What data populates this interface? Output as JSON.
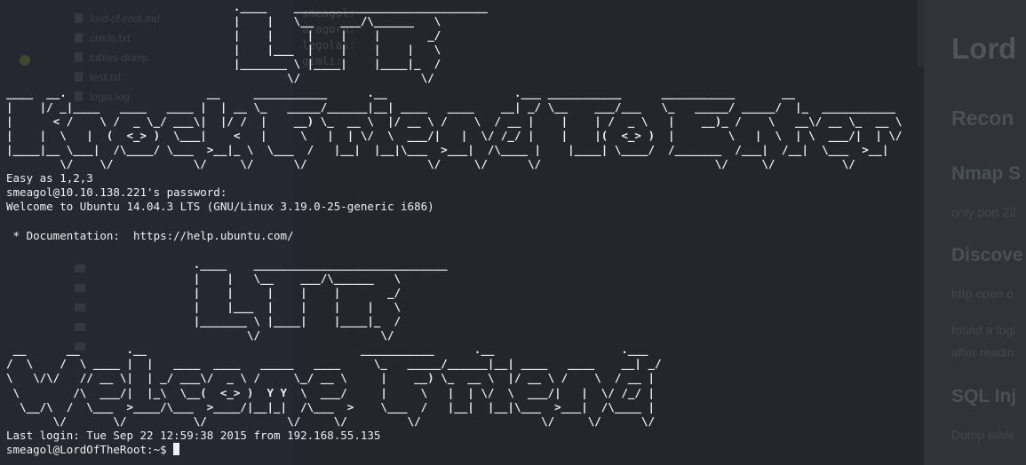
{
  "editor": {
    "files": [
      {
        "kind": "file",
        "name": "lord-of-root.md"
      },
      {
        "kind": "file",
        "name": "creds.txt"
      },
      {
        "kind": "file",
        "name": "tables-dump"
      },
      {
        "kind": "file",
        "name": "test.txt"
      },
      {
        "kind": "file",
        "name": "login.log"
      },
      {
        "kind": "folder",
        "name": ""
      },
      {
        "kind": "folder",
        "name": ""
      },
      {
        "kind": "folder",
        "name": ""
      },
      {
        "kind": "folder",
        "name": ""
      },
      {
        "kind": "folder",
        "name": ""
      }
    ],
    "creds_preview": "smeagol:\naragorn:\nlegolas:\ngimli:"
  },
  "preview": {
    "title": "Lord",
    "recon": "Recon",
    "nmap": "Nmap S",
    "nmap_text": "only port 22",
    "discover": "Discove",
    "discover_text_1": "http open o",
    "discover_text_2": "found a logi",
    "discover_text_3": "after readin",
    "sqli": "SQL Inj",
    "sqli_text": "Dump table"
  },
  "terminal": {
    "banner_ltr_top": "                                  .____    _____________________________\n                                  |    |   \\__    ___/\\______   \\\n                                  |    |     |    |    |       _/\n                                  |    |___  |    |    |    |   \\\n                                  |_______ \\ |____|    |____|_  /\n                                          \\/                  \\/",
    "banner_knock": "____  __.                     __     ___________      .__                   .___ ___________      ___________       __\n|    |/ _|____   ____   ____ |  | __ \\_   _____/______|__| ____   ____    __| _/ \\__    ___/___   \\_   _____/ _____/  |_  ___________\n|      < /    \\ /  _ \\_/ ___\\|  |/ /  |    __) \\_  __ \\  |/ __ \\ /    \\  / __ |    |    | /  _ \\   |    __)_ /    \\   __\\/ __ \\_  __ \\\n|    |  \\   |  (  <_> )  \\___|    <   |     \\   |  | \\/  \\  ___/|   |  \\/ /_/ |    |    |(  <_> )  |        \\   |  \\  | \\  ___/|  | \\/\n|____|__ \\___|  /\\____/ \\___  >__|_ \\  \\___  /   |__|  |__|\\___  >___|  /\\____ |    |____| \\____/  /_______  /___|  /__|  \\___  >__|\n        \\/    \\/            \\/     \\/      \\/                  \\/     \\/      \\/                          \\/     \\/          \\/",
    "easy_line": "Easy as 1,2,3",
    "password_prompt": "smeagol@10.10.138.221's password:",
    "welcome_line": "Welcome to Ubuntu 14.04.3 LTS (GNU/Linux 3.19.0-25-generic i686)",
    "doc_line": " * Documentation:  https://help.ubuntu.com/",
    "banner_ltr_bottom": "                            .____    _____________________________\n                            |    |   \\__    ___/\\______   \\\n                            |    |     |    |    |       _/\n                            |    |___  |    |    |    |   \\\n                            |_______ \\ |____|    |____|_  /\n                                    \\/                  \\/",
    "banner_welcome": " __      __       .__                                ___________      .__                   .___\n/  \\    /  \\ ____ |  |   ____  ____   _____   ____     \\_   _____/______|__| ____   ____    __| _/\n\\   \\/\\/   // __ \\|  | _/ ___\\/  _ \\ /     \\_/ __ \\     |    __) \\_  __ \\  |/ __ \\ /    \\  / __ |\n \\        /\\  ___/|  |_\\  \\__(  <_> )  Y Y  \\  ___/     |     \\   |  | \\/  \\  ___/|   |  \\/ /_/ |\n  \\__/\\  /  \\___  >____/\\___  >____/|__|_|  /\\___  >    \\___  /   |__|  |__|\\___  >___|  /\\____ |\n       \\/       \\/          \\/            \\/     \\/         \\/                  \\/     \\/      \\/",
    "last_login": "Last login: Tue Sep 22 12:59:38 2015 from 192.168.55.135",
    "prompt": "smeagol@LordOfTheRoot:~$ "
  }
}
